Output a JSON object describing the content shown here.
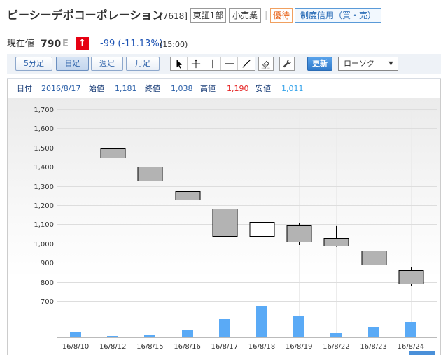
{
  "header": {
    "company_name": "ピーシーデポコーポレーション",
    "code": "[7618]",
    "market": "東証1部",
    "industry": "小売業",
    "separator": "|",
    "benefit": "優待",
    "margin_trading": "制度信用（買・売）"
  },
  "price": {
    "label": "現在値",
    "value": "790",
    "flag": "E",
    "arrow": "↑",
    "change": "-99 (-11.13%)",
    "time": "(15:00)"
  },
  "toolbar": {
    "tabs": [
      {
        "label": "5分足",
        "selected": false
      },
      {
        "label": "日足",
        "selected": true
      },
      {
        "label": "週足",
        "selected": false
      },
      {
        "label": "月足",
        "selected": false
      }
    ],
    "drawing_tools": [
      "cursor-arrow-icon",
      "crosshair-icon",
      "vertical-line-icon",
      "horizontal-line-icon",
      "trend-line-icon"
    ],
    "eraser_icon": "eraser-icon",
    "settings_icon": "wrench-icon",
    "refresh_label": "更新",
    "chart_type": "ローソク",
    "dropdown_arrow": "▼"
  },
  "ohlc": {
    "date_label": "日付",
    "date": "2016/8/17",
    "open_label": "始値",
    "open": "1,181",
    "close_label": "終値",
    "close": "1,038",
    "high_label": "高値",
    "high": "1,190",
    "low_label": "安値",
    "low": "1,011"
  },
  "colors": {
    "text": "#333333",
    "accent_blue": "#2a5fa8",
    "change_blue": "#1f55b5",
    "benefit_orange": "#e8641b",
    "arrow_badge_red": "#e60012",
    "high_red": "#e52222",
    "low_lightblue": "#35a3ea",
    "refresh_button": "#3a8ce0"
  },
  "chart_data": {
    "type": "bar",
    "categories": [
      "16/8/10",
      "16/8/12",
      "16/8/15",
      "16/8/16",
      "16/8/17",
      "16/8/18",
      "16/8/19",
      "16/8/22",
      "16/8/23",
      "16/8/24"
    ],
    "open": [
      1500,
      1496,
      1400,
      1273,
      1181,
      1038,
      1094,
      1028,
      962,
      862
    ],
    "high": [
      1620,
      1528,
      1441,
      1295,
      1190,
      1128,
      1105,
      1091,
      967,
      875
    ],
    "low": [
      1485,
      1445,
      1308,
      1182,
      1011,
      1000,
      992,
      983,
      850,
      780
    ],
    "close": [
      1500,
      1448,
      1328,
      1229,
      1038,
      1113,
      1012,
      990,
      889,
      790
    ],
    "volume": [
      18,
      4,
      9,
      22,
      60,
      100,
      69,
      16,
      33,
      49
    ],
    "ylim": [
      700,
      1700
    ],
    "ytick_labels": [
      "1,700",
      "1,600",
      "1,500",
      "1,400",
      "1,300",
      "1,200",
      "1,100",
      "1,000",
      "900",
      "800",
      "700"
    ],
    "grid": true,
    "up_color": "#ffffff",
    "down_color": "#b3b3b3",
    "outline_color": "#000000",
    "volume_color": "#5aaaf6",
    "grid_color": "#dddddd"
  }
}
